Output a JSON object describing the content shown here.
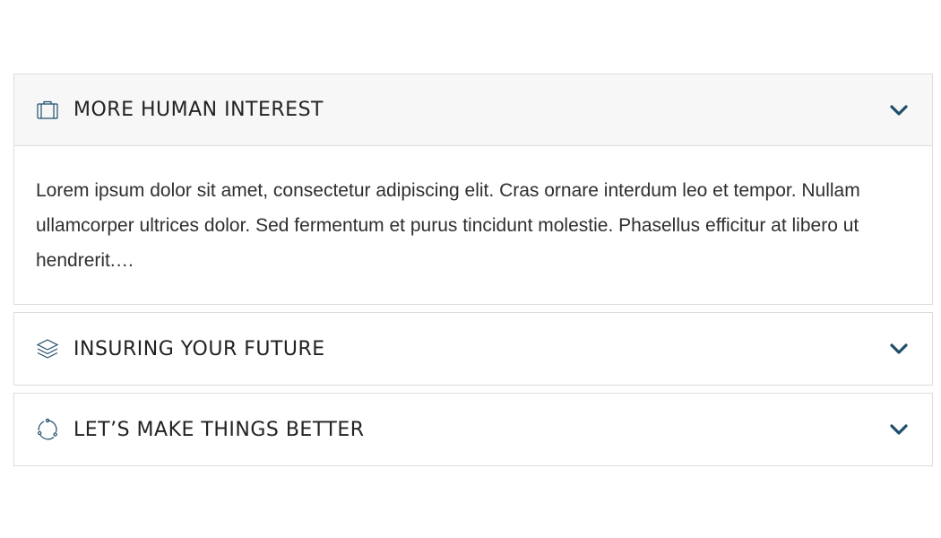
{
  "accordion": {
    "items": [
      {
        "title": "MORE HUMAN INTEREST",
        "icon": "briefcase-icon",
        "open": true,
        "body": "Lorem ipsum dolor sit amet, consectetur adipiscing elit. Cras ornare interdum leo et tempor. Nullam ullamcorper ultrices dolor. Sed fermentum et purus tincidunt molestie. Phasellus efficitur at libero ut hendrerit.…"
      },
      {
        "title": "INSURING YOUR FUTURE",
        "icon": "layers-icon",
        "open": false
      },
      {
        "title": "LET’S MAKE THINGS BETTER",
        "icon": "refresh-cycle-icon",
        "open": false
      }
    ],
    "chevron_icon": "chevron-down-icon"
  },
  "colors": {
    "accent": "#1f4e6b",
    "header_bg_open": "#f7f7f7",
    "border": "#dddddd",
    "text": "#2f2f2f"
  }
}
